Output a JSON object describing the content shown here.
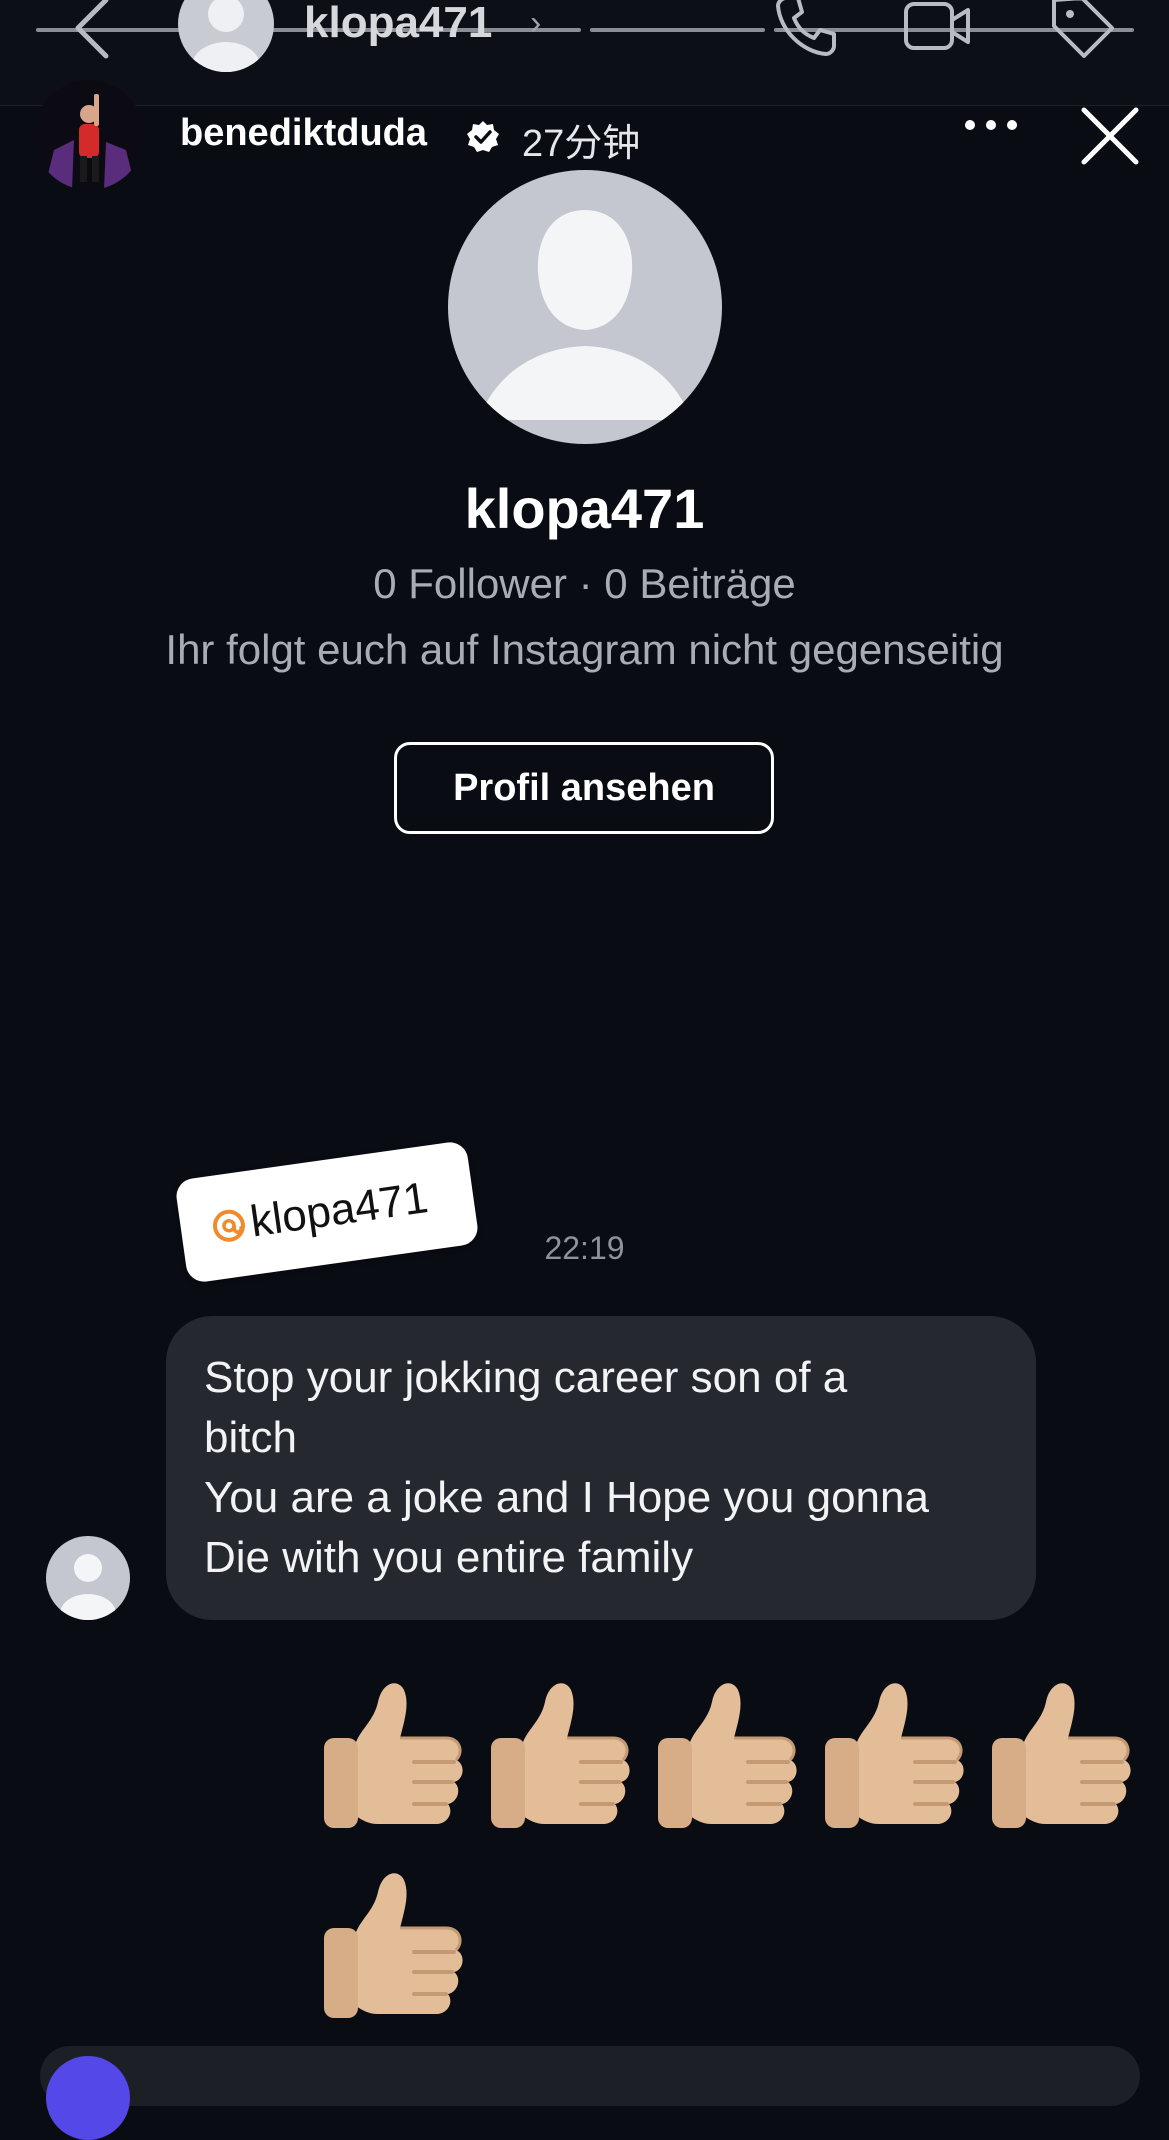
{
  "dm_header": {
    "username": "klopa471",
    "chevron": "›",
    "icons": [
      "back-arrow-icon",
      "phone-icon",
      "video-camera-icon",
      "tag-icon"
    ]
  },
  "story": {
    "username": "benediktduda",
    "verified": true,
    "time_ago": "27分钟"
  },
  "profile": {
    "name": "klopa471",
    "stats": "0 Follower · 0 Beiträge",
    "mutual": "Ihr folgt euch auf Instagram nicht gegenseitig",
    "button_label": "Profil ansehen"
  },
  "mention": {
    "text": "klopa471",
    "icon": "threads-icon"
  },
  "timestamp": "22:19",
  "message": {
    "lines": [
      "Stop your jokking career son of a",
      "bitch",
      "You are a joke and I Hope you gonna",
      "Die with you entire family"
    ]
  },
  "reactions": {
    "emoji": "thumbs-up",
    "count": 6
  },
  "colors": {
    "background": "#0a0c14",
    "bubble": "#262830",
    "secondary_text": "#a9acb3",
    "threads_accent": "#f08a2a"
  }
}
